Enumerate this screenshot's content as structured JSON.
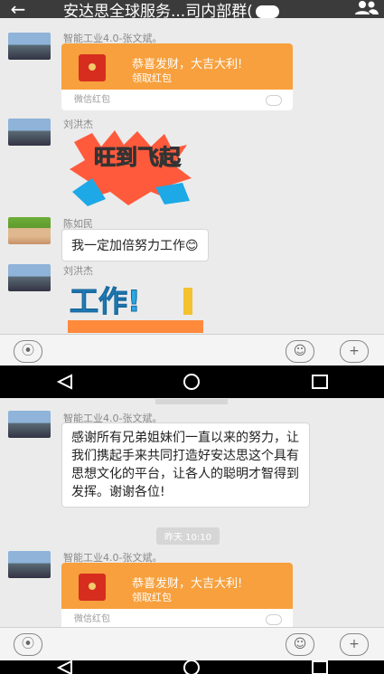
{
  "header": {
    "back_icon": "←",
    "title": "安达思全球服务...司内部群(",
    "people_icon": "people-icon"
  },
  "messages": [
    {
      "sender": "智能工业4.0-张文斌。",
      "type": "red_packet",
      "greeting": "恭喜发财，大吉大利!",
      "action": "领取红包",
      "footer": "微信红包"
    },
    {
      "sender": "刘洪杰",
      "type": "sticker",
      "sticker_text": "旺到飞起"
    },
    {
      "sender": "陈如民",
      "type": "text",
      "text": "我一定加倍努力工作😊"
    },
    {
      "sender": "刘洪杰",
      "type": "sticker",
      "sticker_text": "工作!"
    }
  ],
  "second_screen": {
    "message1": {
      "sender": "智能工业4.0-张文斌。",
      "text": "感谢所有兄弟姐妹们一直以来的努力，让我们携起手来共同打造好安达思这个具有思想文化的平台，让各人的聪明才智得到发挥。谢谢各位!"
    },
    "timestamp": "昨天 10:10",
    "message2": {
      "sender": "智能工业4.0-张文斌。",
      "greeting": "恭喜发财，大吉大利!",
      "action": "领取红包",
      "footer": "微信红包"
    }
  },
  "input_bar": {
    "voice_icon": "voice-icon",
    "emoji_icon": "emoji-icon",
    "plus_icon": "plus-icon"
  },
  "colors": {
    "red_packet": "#f7a03d",
    "header_bg": "#3b3b3b",
    "chat_bg": "#ebebeb"
  }
}
